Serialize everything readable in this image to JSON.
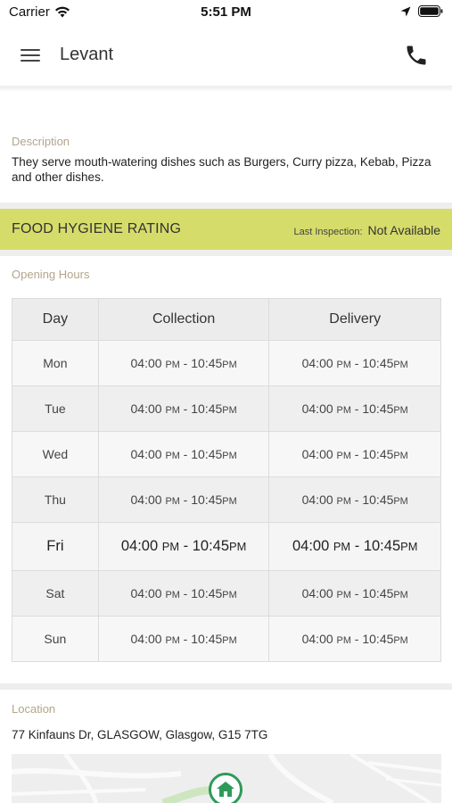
{
  "status_bar": {
    "carrier": "Carrier",
    "time": "5:51 PM",
    "icons": [
      "wifi-icon",
      "location-arrow-icon",
      "battery-icon"
    ]
  },
  "nav": {
    "title": "Levant",
    "icons": [
      "menu-icon",
      "phone-icon"
    ]
  },
  "description": {
    "label": "Description",
    "text": "They serve mouth-watering dishes such as Burgers, Curry pizza, Kebab, Pizza and other dishes."
  },
  "hygiene": {
    "title": "FOOD HYGIENE RATING",
    "last_inspection_label": "Last Inspection:",
    "value": "Not Available"
  },
  "opening_hours": {
    "label": "Opening Hours",
    "headers": [
      "Day",
      "Collection",
      "Delivery"
    ],
    "rows": [
      {
        "day": "Mon",
        "col_open": "04:00",
        "col_open_ampm": "PM",
        "col_close": "10:45",
        "col_close_ampm": "PM",
        "del_open": "04:00",
        "del_open_ampm": "PM",
        "del_close": "10:45",
        "del_close_ampm": "PM"
      },
      {
        "day": "Tue",
        "col_open": "04:00",
        "col_open_ampm": "PM",
        "col_close": "10:45",
        "col_close_ampm": "PM",
        "del_open": "04:00",
        "del_open_ampm": "PM",
        "del_close": "10:45",
        "del_close_ampm": "PM"
      },
      {
        "day": "Wed",
        "col_open": "04:00",
        "col_open_ampm": "PM",
        "col_close": "10:45",
        "col_close_ampm": "PM",
        "del_open": "04:00",
        "del_open_ampm": "PM",
        "del_close": "10:45",
        "del_close_ampm": "PM"
      },
      {
        "day": "Thu",
        "col_open": "04:00",
        "col_open_ampm": "PM",
        "col_close": "10:45",
        "col_close_ampm": "PM",
        "del_open": "04:00",
        "del_open_ampm": "PM",
        "del_close": "10:45",
        "del_close_ampm": "PM"
      },
      {
        "day": "Fri",
        "col_open": "04:00",
        "col_open_ampm": "PM",
        "col_close": "10:45",
        "col_close_ampm": "PM",
        "del_open": "04:00",
        "del_open_ampm": "PM",
        "del_close": "10:45",
        "del_close_ampm": "PM"
      },
      {
        "day": "Sat",
        "col_open": "04:00",
        "col_open_ampm": "PM",
        "col_close": "10:45",
        "col_close_ampm": "PM",
        "del_open": "04:00",
        "del_open_ampm": "PM",
        "del_close": "10:45",
        "del_close_ampm": "PM"
      },
      {
        "day": "Sun",
        "col_open": "04:00",
        "col_open_ampm": "PM",
        "col_close": "10:45",
        "col_close_ampm": "PM",
        "del_open": "04:00",
        "del_open_ampm": "PM",
        "del_close": "10:45",
        "del_close_ampm": "PM"
      }
    ],
    "highlight_day": "Fri"
  },
  "location": {
    "label": "Location",
    "address": "77 Kinfauns Dr, GLASGOW, Glasgow, G15 7TG",
    "map_marker_icon": "home-marker-icon"
  },
  "colors": {
    "hygiene_band": "#d6dc6a",
    "section_label": "#b3a58a",
    "map_marker": "#2e9a5a"
  }
}
